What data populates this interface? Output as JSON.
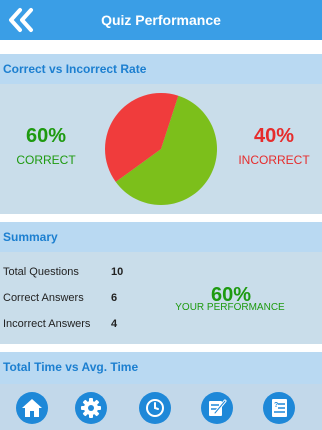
{
  "header": {
    "title": "Quiz Performance",
    "back_icon": "double-chevron-left-icon"
  },
  "correct_vs_incorrect": {
    "title": "Correct vs Incorrect Rate",
    "correct_percent": "60%",
    "correct_label": "CORRECT",
    "incorrect_percent": "40%",
    "incorrect_label": "INCORRECT",
    "pie": {
      "correct_fraction": 0.6,
      "incorrect_fraction": 0.4,
      "correct_color": "#7cbf1b",
      "incorrect_color": "#f03c3c"
    }
  },
  "summary": {
    "title": "Summary",
    "rows": [
      {
        "label": "Total Questions",
        "value": "10"
      },
      {
        "label": "Correct Answers",
        "value": "6"
      },
      {
        "label": "Incorrect Answers",
        "value": "4"
      }
    ],
    "performance_percent": "60%",
    "performance_label": "YOUR PERFORMANCE"
  },
  "time_section": {
    "title": "Total Time vs Avg. Time"
  },
  "bottom_nav": [
    {
      "icon": "home-icon"
    },
    {
      "icon": "settings-gear-icon"
    },
    {
      "icon": "clock-icon"
    },
    {
      "icon": "edit-note-icon"
    },
    {
      "icon": "quiz-list-icon"
    }
  ],
  "colors": {
    "header": "#3a9ee6",
    "accent_blue": "#1c7fd0",
    "green": "#1e9a10",
    "red": "#e62c2c"
  }
}
